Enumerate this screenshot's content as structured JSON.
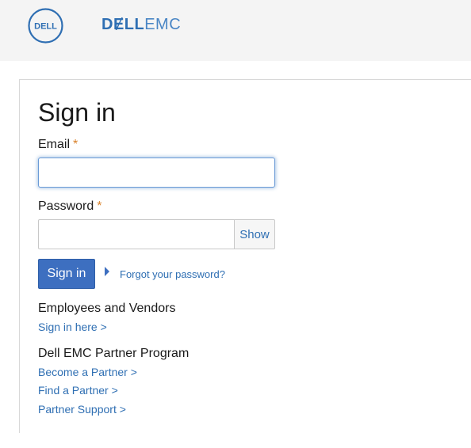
{
  "header": {
    "dell_logo_text": "DELL",
    "brand_dell": "DɆLL",
    "brand_emc": "EMC"
  },
  "form": {
    "title": "Sign in",
    "email_label": "Email",
    "password_label": "Password",
    "required_mark": "*",
    "email_value": "",
    "password_value": "",
    "show_label": "Show",
    "signin_label": "Sign in",
    "forgot_label": "Forgot your password?"
  },
  "employees": {
    "heading": "Employees and Vendors",
    "links": [
      "Sign in here >"
    ]
  },
  "partners": {
    "heading": "Dell EMC Partner Program",
    "links": [
      "Become a Partner >",
      "Find a Partner >",
      "Partner Support >"
    ]
  },
  "colors": {
    "accent": "#2f6fb3",
    "button": "#3d6fc0",
    "required": "#d9822b",
    "topbar": "#f4f4f4"
  }
}
